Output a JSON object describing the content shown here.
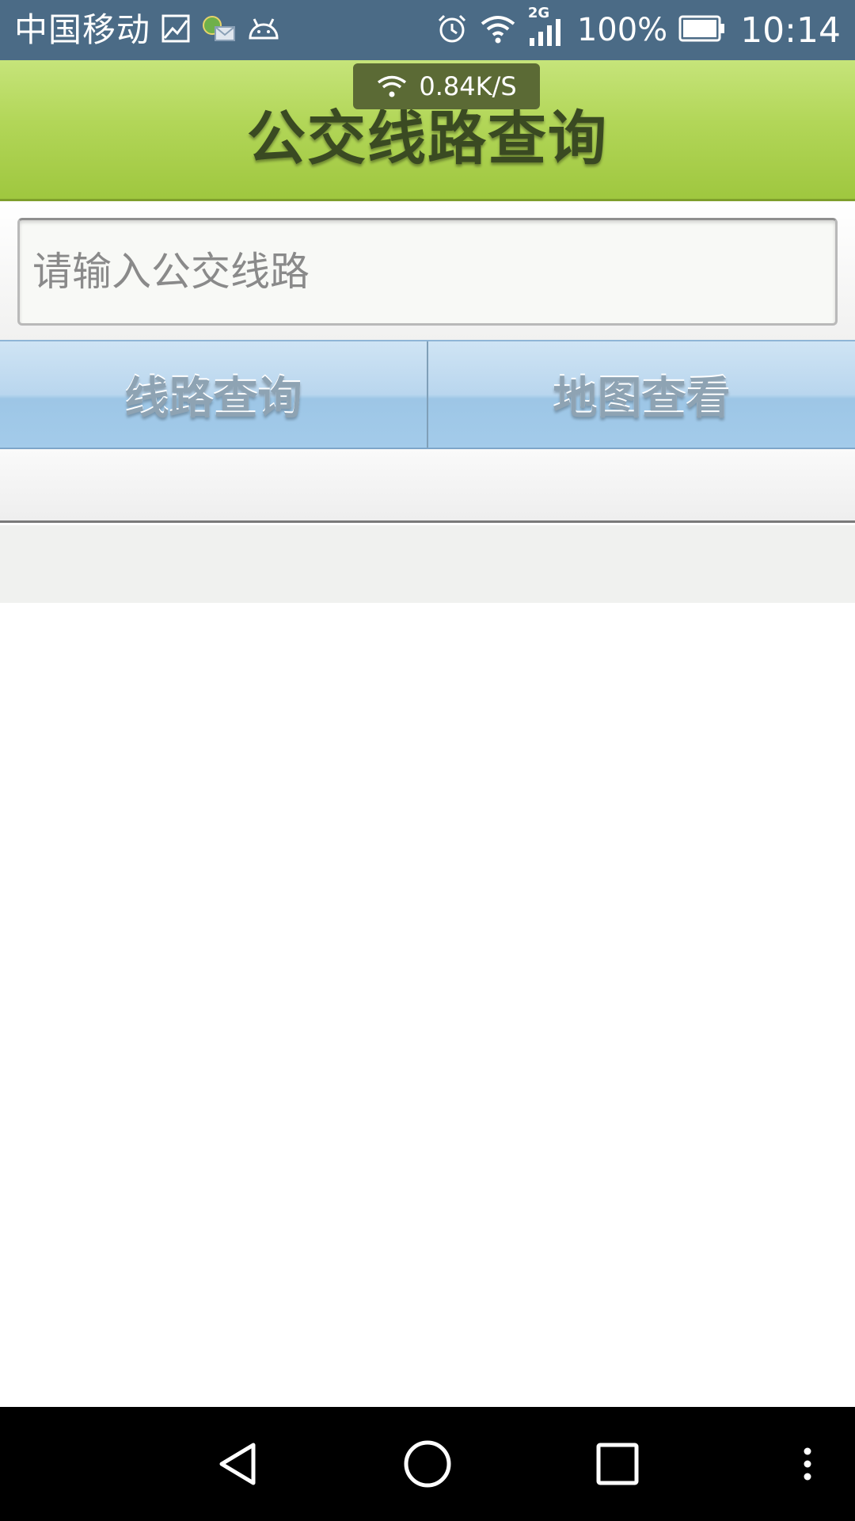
{
  "status_bar": {
    "carrier": "中国移动",
    "network_type": "2G",
    "battery_percent": "100%",
    "time": "10:14",
    "icons": [
      "image-icon",
      "message-icon",
      "android-icon",
      "alarm-icon",
      "wifi-icon",
      "signal-icon",
      "battery-icon"
    ]
  },
  "network_overlay": {
    "speed": "0.84K/S"
  },
  "header": {
    "title": "公交线路查询",
    "accent_color": "#b2d658"
  },
  "search": {
    "value": "",
    "placeholder": "请输入公交线路"
  },
  "actions": {
    "route_query_label": "线路查询",
    "map_view_label": "地图查看",
    "button_color": "#b9d6ee"
  },
  "nav_bar": {
    "icons": [
      "back-icon",
      "home-icon",
      "recents-icon",
      "more-icon"
    ]
  }
}
